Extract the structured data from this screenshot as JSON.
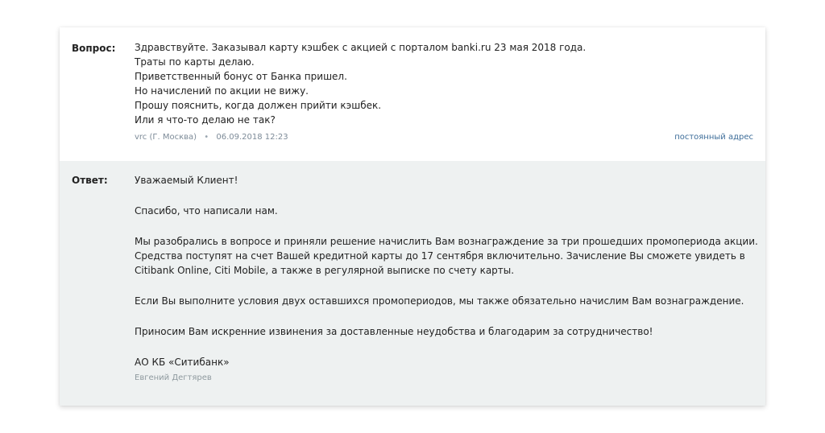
{
  "question": {
    "label": "Вопрос:",
    "lines": [
      "Здравствуйте. Заказывал карту кэшбек с акцией с порталом banki.ru 23 мая 2018 года.",
      "Траты по карты делаю.",
      "Приветственный бонус от Банка пришел.",
      "Но начислений по акции не вижу.",
      "Прошу пояснить, когда должен прийти кэшбек.",
      "Или я что-то делаю не так?"
    ],
    "author": "vrc",
    "city": "(Г. Москва)",
    "separator": "•",
    "datetime": "06.09.2018 12:23",
    "permalink": "постоянный адрес"
  },
  "answer": {
    "label": "Ответ:",
    "paragraphs": [
      "Уважаемый Клиент!",
      "Спасибо, что написали нам.",
      "Мы разобрались в вопросе и приняли решение начислить Вам вознаграждение за три прошедших промопериода акции. Средства поступят на счет Вашей кредитной карты до 17 сентября включительно. Зачисление Вы сможете увидеть в Citibank Online, Citi Mobile, а также в регулярной выписке по счету карты.",
      "Если Вы выполните условия двух оставшихся промопериодов, мы также обязательно начислим Вам вознаграждение.",
      "Приносим Вам искренние извинения за доставленные неудобства и благодарим за сотрудничество!"
    ],
    "signature": "АО КБ «Ситибанк»",
    "author": "Евгений Дегтярев"
  },
  "colors": {
    "answer_background": "#eef1f1",
    "meta_text": "#7d8b98",
    "link": "#3d6d99"
  }
}
